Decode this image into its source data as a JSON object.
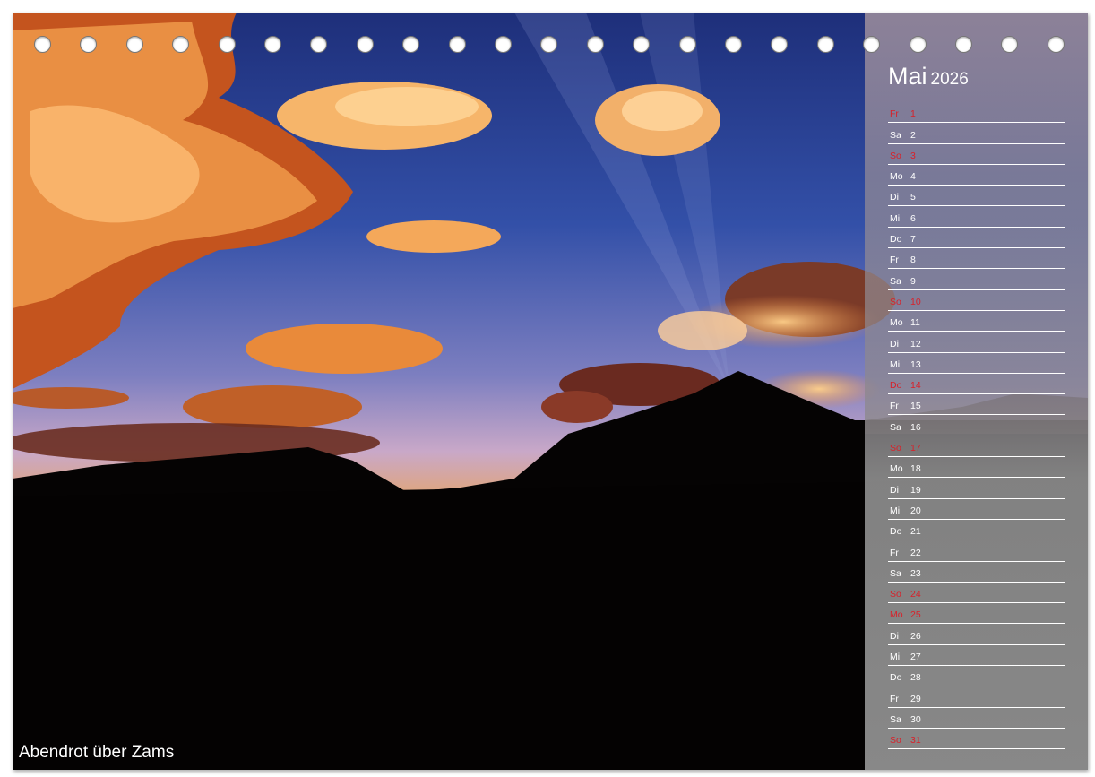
{
  "photo": {
    "caption": "Abendrot über Zams",
    "colors": {
      "sky_top": "#2a3f8f",
      "sky_horizon": "#c9a8c8",
      "cloud_glow": "#f2a04a",
      "silhouette": "#050303"
    }
  },
  "calendar": {
    "month": "Mai",
    "year": "2026",
    "days": [
      {
        "weekday": "Fr",
        "day": "1",
        "highlight": true
      },
      {
        "weekday": "Sa",
        "day": "2",
        "highlight": false
      },
      {
        "weekday": "So",
        "day": "3",
        "highlight": true
      },
      {
        "weekday": "Mo",
        "day": "4",
        "highlight": false
      },
      {
        "weekday": "Di",
        "day": "5",
        "highlight": false
      },
      {
        "weekday": "Mi",
        "day": "6",
        "highlight": false
      },
      {
        "weekday": "Do",
        "day": "7",
        "highlight": false
      },
      {
        "weekday": "Fr",
        "day": "8",
        "highlight": false
      },
      {
        "weekday": "Sa",
        "day": "9",
        "highlight": false
      },
      {
        "weekday": "So",
        "day": "10",
        "highlight": true
      },
      {
        "weekday": "Mo",
        "day": "11",
        "highlight": false
      },
      {
        "weekday": "Di",
        "day": "12",
        "highlight": false
      },
      {
        "weekday": "Mi",
        "day": "13",
        "highlight": false
      },
      {
        "weekday": "Do",
        "day": "14",
        "highlight": true
      },
      {
        "weekday": "Fr",
        "day": "15",
        "highlight": false
      },
      {
        "weekday": "Sa",
        "day": "16",
        "highlight": false
      },
      {
        "weekday": "So",
        "day": "17",
        "highlight": true
      },
      {
        "weekday": "Mo",
        "day": "18",
        "highlight": false
      },
      {
        "weekday": "Di",
        "day": "19",
        "highlight": false
      },
      {
        "weekday": "Mi",
        "day": "20",
        "highlight": false
      },
      {
        "weekday": "Do",
        "day": "21",
        "highlight": false
      },
      {
        "weekday": "Fr",
        "day": "22",
        "highlight": false
      },
      {
        "weekday": "Sa",
        "day": "23",
        "highlight": false
      },
      {
        "weekday": "So",
        "day": "24",
        "highlight": true
      },
      {
        "weekday": "Mo",
        "day": "25",
        "highlight": true
      },
      {
        "weekday": "Di",
        "day": "26",
        "highlight": false
      },
      {
        "weekday": "Mi",
        "day": "27",
        "highlight": false
      },
      {
        "weekday": "Do",
        "day": "28",
        "highlight": false
      },
      {
        "weekday": "Fr",
        "day": "29",
        "highlight": false
      },
      {
        "weekday": "Sa",
        "day": "30",
        "highlight": false
      },
      {
        "weekday": "So",
        "day": "31",
        "highlight": true
      }
    ],
    "colors": {
      "highlight": "#d8212a",
      "normal": "#ffffff"
    }
  },
  "binding": {
    "ring_count": 23,
    "ring_icon": "binding-ring-icon"
  }
}
